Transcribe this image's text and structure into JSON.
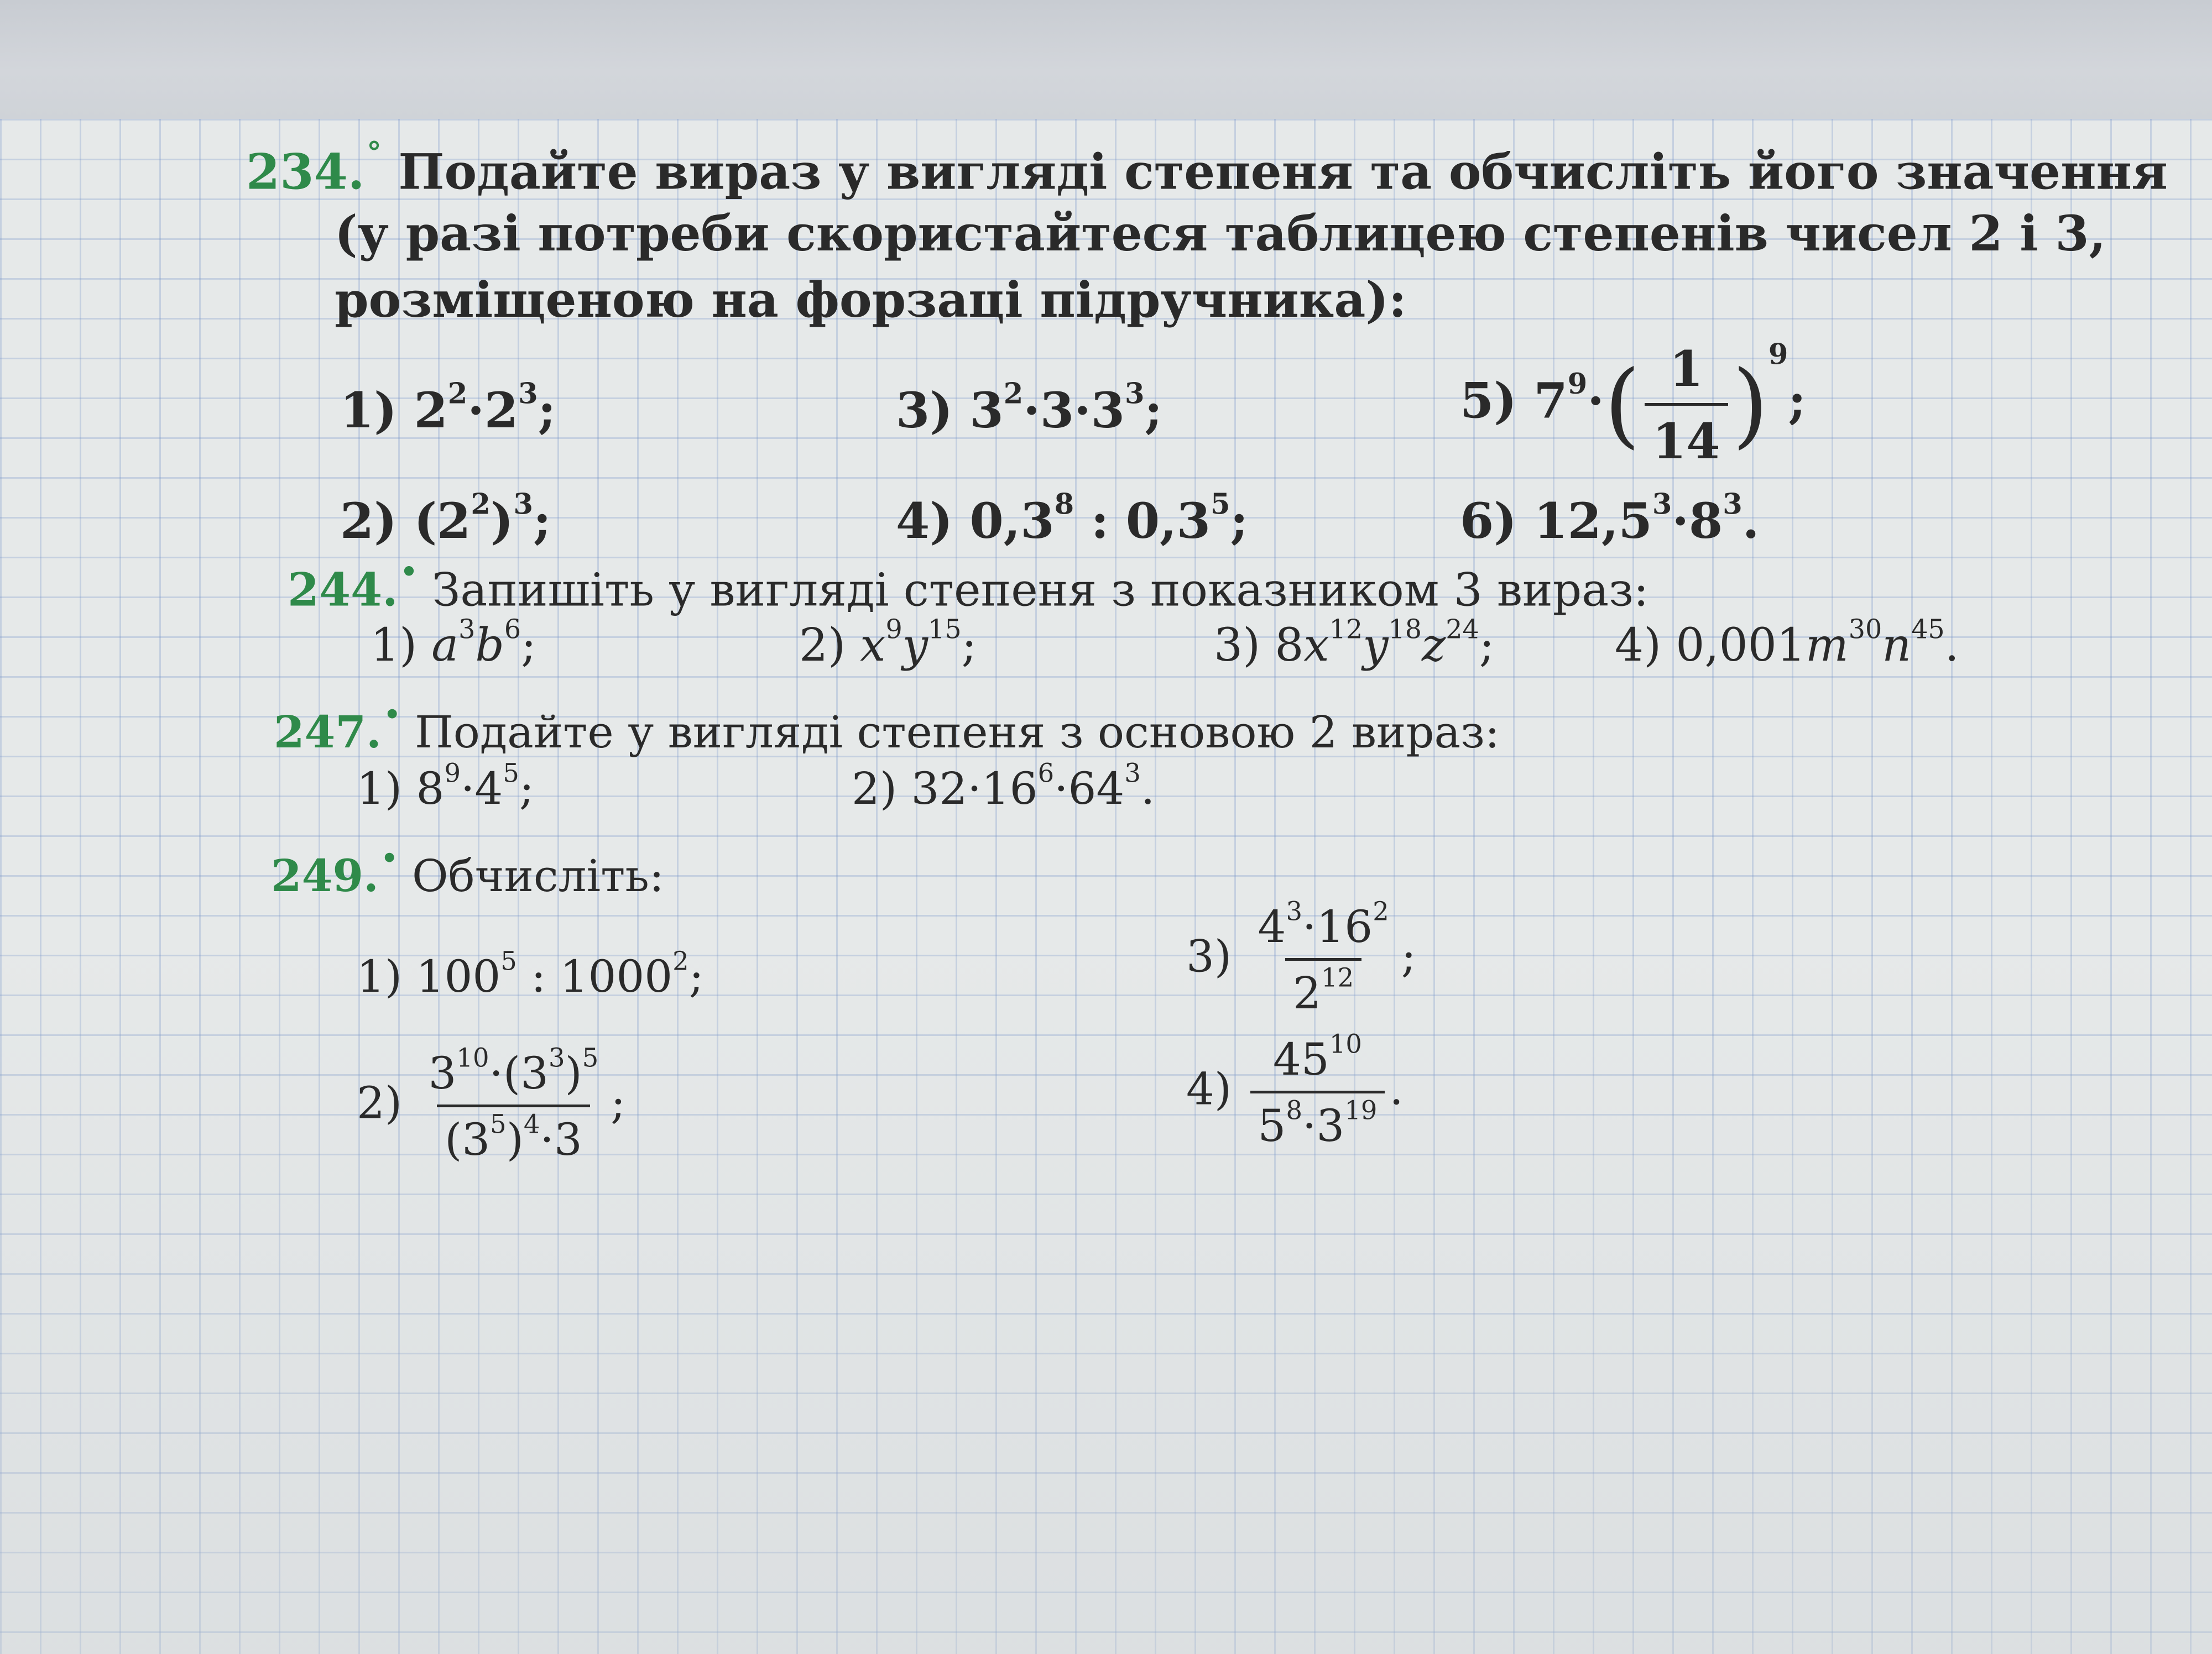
{
  "ex234": {
    "number": "234.",
    "mark": "°",
    "text1": "Подайте вираз у вигляді степеня та обчисліть його значення",
    "text2": "(у разі потреби скористайтеся таблицею степенів чисел 2 і 3,",
    "text3": "розміщеною на форзаці підручника):",
    "items": [
      {
        "label": "1)",
        "base1": "2",
        "exp1": "2",
        "op": "·",
        "base2": "2",
        "exp2": "3",
        "end": ";"
      },
      {
        "label": "2)",
        "open": "(2",
        "inner_exp": "2",
        "close": ")",
        "outer_exp": "3",
        "end": ";"
      },
      {
        "label": "3)",
        "base1": "3",
        "exp1": "2",
        "mid": "·3·",
        "base2": "3",
        "exp2": "3",
        "end": ";"
      },
      {
        "label": "4)",
        "base1": "0,3",
        "exp1": "8",
        "op": " : ",
        "base2": "0,3",
        "exp2": "5",
        "end": ";"
      },
      {
        "label": "5)",
        "base1": "7",
        "exp1": "9",
        "op": "·",
        "frac_num": "1",
        "frac_den": "14",
        "outer_exp": "9",
        "end": ";"
      },
      {
        "label": "6)",
        "base1": "12,5",
        "exp1": "3",
        "op": "·",
        "base2": "8",
        "exp2": "3",
        "end": "."
      }
    ]
  },
  "ex244": {
    "number": "244.",
    "mark": "•",
    "text": "Запишіть у вигляді степеня з показником 3 вираз:",
    "items": [
      {
        "label": "1)",
        "v1": "a",
        "e1": "3",
        "v2": "b",
        "e2": "6",
        "end": ";"
      },
      {
        "label": "2)",
        "v1": "x",
        "e1": "9",
        "v2": "y",
        "e2": "15",
        "end": ";"
      },
      {
        "label": "3)",
        "coef": "8",
        "v1": "x",
        "e1": "12",
        "v2": "y",
        "e2": "18",
        "v3": "z",
        "e3": "24",
        "end": ";"
      },
      {
        "label": "4)",
        "coef": "0,001",
        "v1": "m",
        "e1": "30",
        "v2": "n",
        "e2": "45",
        "end": "."
      }
    ]
  },
  "ex247": {
    "number": "247.",
    "mark": "•",
    "text": "Подайте у вигляді степеня з основою 2 вираз:",
    "items": [
      {
        "label": "1)",
        "base1": "8",
        "exp1": "9",
        "op": "·",
        "base2": "4",
        "exp2": "5",
        "end": ";"
      },
      {
        "label": "2)",
        "pre": "32·",
        "base1": "16",
        "exp1": "6",
        "op": "·",
        "base2": "64",
        "exp2": "3",
        "end": "."
      }
    ]
  },
  "ex249": {
    "number": "249.",
    "mark": "•",
    "text": "Обчисліть:",
    "items": [
      {
        "label": "1)",
        "base1": "100",
        "exp1": "5",
        "op": " : ",
        "base2": "1000",
        "exp2": "2",
        "end": ";"
      },
      {
        "label": "2)",
        "n_b1": "3",
        "n_e1": "10",
        "n_mid": "·(3",
        "n_e2": "3",
        "n_close": ")",
        "n_e3": "5",
        "d_open": "(3",
        "d_e1": "5",
        "d_close": ")",
        "d_e2": "4",
        "d_tail": "·3",
        "end": ";"
      },
      {
        "label": "3)",
        "n_b1": "4",
        "n_e1": "3",
        "n_op": "·",
        "n_b2": "16",
        "n_e2": "2",
        "d_b": "2",
        "d_e": "12",
        "end": ";"
      },
      {
        "label": "4)",
        "n_b": "45",
        "n_e": "10",
        "d_b1": "5",
        "d_e1": "8",
        "d_op": "·",
        "d_b2": "3",
        "d_e2": "19",
        "end": "."
      }
    ]
  }
}
